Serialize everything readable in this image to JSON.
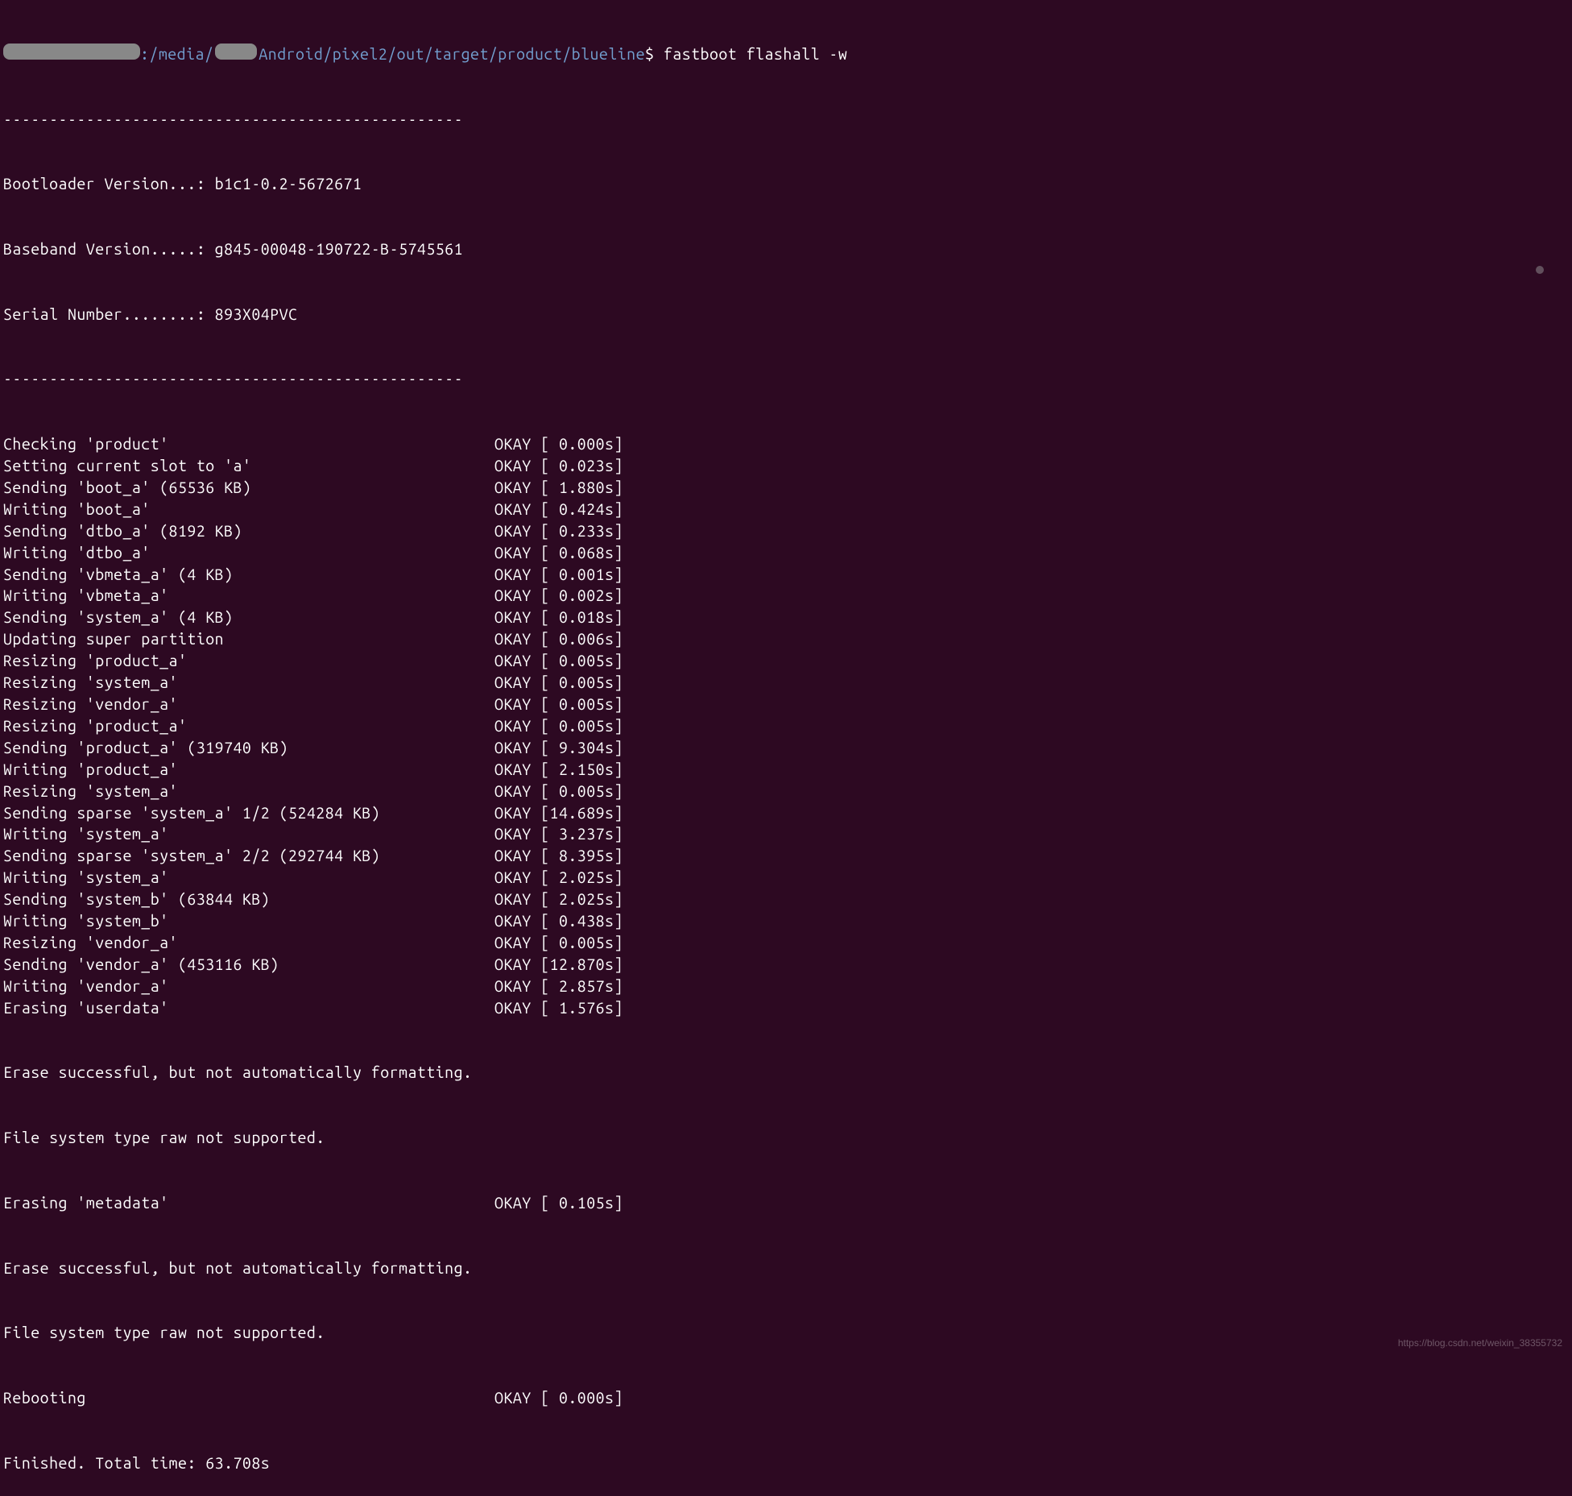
{
  "prompt": {
    "path_prefix": ":/media/",
    "path_suffix": "Android/pixel2/out/target/product/blueline",
    "dollar": "$",
    "command": "fastboot flashall -w"
  },
  "divider": "--------------------------------------------------",
  "header": {
    "bootloader_label": "Bootloader Version...: ",
    "bootloader_value": "b1c1-0.2-5672671",
    "baseband_label": "Baseband Version.....: ",
    "baseband_value": "g845-00048-190722-B-5745561",
    "serial_label": "Serial Number........: ",
    "serial_value": "893X04PVC"
  },
  "steps": [
    {
      "action": "Checking 'product'",
      "time": "0.000s"
    },
    {
      "action": "Setting current slot to 'a'",
      "time": "0.023s"
    },
    {
      "action": "Sending 'boot_a' (65536 KB)",
      "time": "1.880s"
    },
    {
      "action": "Writing 'boot_a'",
      "time": "0.424s"
    },
    {
      "action": "Sending 'dtbo_a' (8192 KB)",
      "time": "0.233s"
    },
    {
      "action": "Writing 'dtbo_a'",
      "time": "0.068s"
    },
    {
      "action": "Sending 'vbmeta_a' (4 KB)",
      "time": "0.001s"
    },
    {
      "action": "Writing 'vbmeta_a'",
      "time": "0.002s"
    },
    {
      "action": "Sending 'system_a' (4 KB)",
      "time": "0.018s"
    },
    {
      "action": "Updating super partition",
      "time": "0.006s"
    },
    {
      "action": "Resizing 'product_a'",
      "time": "0.005s"
    },
    {
      "action": "Resizing 'system_a'",
      "time": "0.005s"
    },
    {
      "action": "Resizing 'vendor_a'",
      "time": "0.005s"
    },
    {
      "action": "Resizing 'product_a'",
      "time": "0.005s"
    },
    {
      "action": "Sending 'product_a' (319740 KB)",
      "time": "9.304s"
    },
    {
      "action": "Writing 'product_a'",
      "time": "2.150s"
    },
    {
      "action": "Resizing 'system_a'",
      "time": "0.005s"
    },
    {
      "action": "Sending sparse 'system_a' 1/2 (524284 KB)",
      "time": "14.689s"
    },
    {
      "action": "Writing 'system_a'",
      "time": "3.237s"
    },
    {
      "action": "Sending sparse 'system_a' 2/2 (292744 KB)",
      "time": "8.395s"
    },
    {
      "action": "Writing 'system_a'",
      "time": "2.025s"
    },
    {
      "action": "Sending 'system_b' (63844 KB)",
      "time": "2.025s"
    },
    {
      "action": "Writing 'system_b'",
      "time": "0.438s"
    },
    {
      "action": "Resizing 'vendor_a'",
      "time": "0.005s"
    },
    {
      "action": "Sending 'vendor_a' (453116 KB)",
      "time": "12.870s"
    },
    {
      "action": "Writing 'vendor_a'",
      "time": "2.857s"
    },
    {
      "action": "Erasing 'userdata'",
      "time": "1.576s"
    }
  ],
  "msg_erase_ok": "Erase successful, but not automatically formatting.",
  "msg_fs_raw": "File system type raw not supported.",
  "step_metadata": {
    "action": "Erasing 'metadata'",
    "time": "0.105s"
  },
  "step_reboot": {
    "action": "Rebooting",
    "time": "0.000s"
  },
  "finished": "Finished. Total time: 63.708s",
  "okay": "OKAY",
  "watermark": "https://blog.csdn.net/weixin_38355732"
}
